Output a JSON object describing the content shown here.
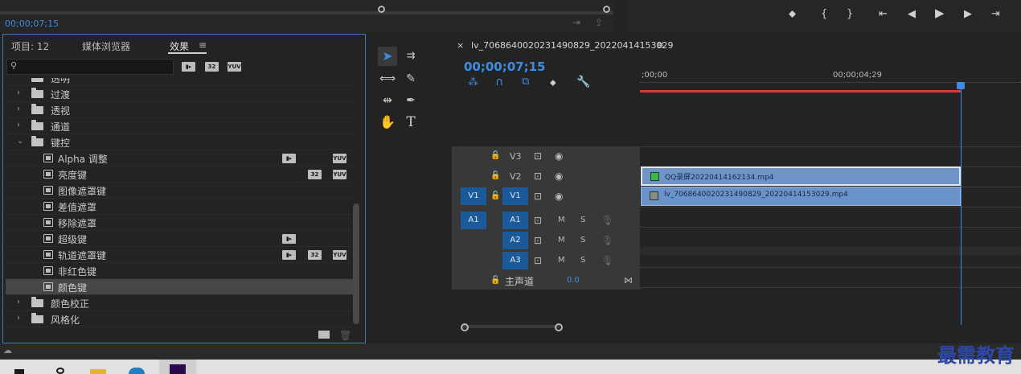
{
  "source_monitor": {
    "timecode": "00;00;07;15"
  },
  "effects_panel": {
    "tabs": [
      {
        "label": "项目: 12"
      },
      {
        "label": "媒体浏览器"
      },
      {
        "label": "效果"
      }
    ],
    "menu_icon": "≡",
    "search": {
      "value": "",
      "icon": "search-icon"
    },
    "badges": [
      "32",
      "YUV"
    ],
    "tree": [
      {
        "label": "透明",
        "type": "folder"
      },
      {
        "label": "过渡",
        "type": "folder"
      },
      {
        "label": "透视",
        "type": "folder"
      },
      {
        "label": "通道",
        "type": "folder"
      },
      {
        "label": "键控",
        "type": "folder-open"
      },
      {
        "label": "Alpha 调整",
        "type": "effect"
      },
      {
        "label": "亮度键",
        "type": "effect"
      },
      {
        "label": "图像遮罩键",
        "type": "effect"
      },
      {
        "label": "差值遮罩",
        "type": "effect"
      },
      {
        "label": "移除遮罩",
        "type": "effect"
      },
      {
        "label": "超级键",
        "type": "effect"
      },
      {
        "label": "轨道遮罩键",
        "type": "effect"
      },
      {
        "label": "非红色键",
        "type": "effect"
      },
      {
        "label": "颜色键",
        "type": "effect",
        "selected": true
      },
      {
        "label": "颜色校正",
        "type": "folder"
      },
      {
        "label": "风格化",
        "type": "folder"
      }
    ]
  },
  "timeline": {
    "sequence_name": "lv_7068640020231490829_20220414153029",
    "close_icon": "×",
    "menu_icon": "≡",
    "timecode": "00;00;07;15",
    "ruler": {
      "start": ";00;00",
      "mid": "00;00;04;29"
    },
    "tracks": {
      "video": [
        {
          "name": "V3"
        },
        {
          "name": "V2"
        },
        {
          "name": "V1",
          "source": "V1"
        }
      ],
      "audio": [
        {
          "name": "A1",
          "source": "A1",
          "m": "M",
          "s": "S"
        },
        {
          "name": "A2",
          "m": "M",
          "s": "S"
        },
        {
          "name": "A3",
          "m": "M",
          "s": "S"
        }
      ],
      "master": {
        "label": "主声道",
        "value": "0.0"
      }
    },
    "clips": [
      {
        "name": "QQ录屏20220414162134.mp4",
        "track": "V2",
        "fx_color": "#3cb44a"
      },
      {
        "name": "lv_7068640020231490829_20220414153029.mp4",
        "track": "V1",
        "fx_color": "#8a8a8a"
      }
    ]
  },
  "watermark": "最需教育",
  "colors": {
    "accent": "#3d8ee2",
    "playhead_in": "#d63a3a",
    "track_blue": "#1b5a9a"
  }
}
